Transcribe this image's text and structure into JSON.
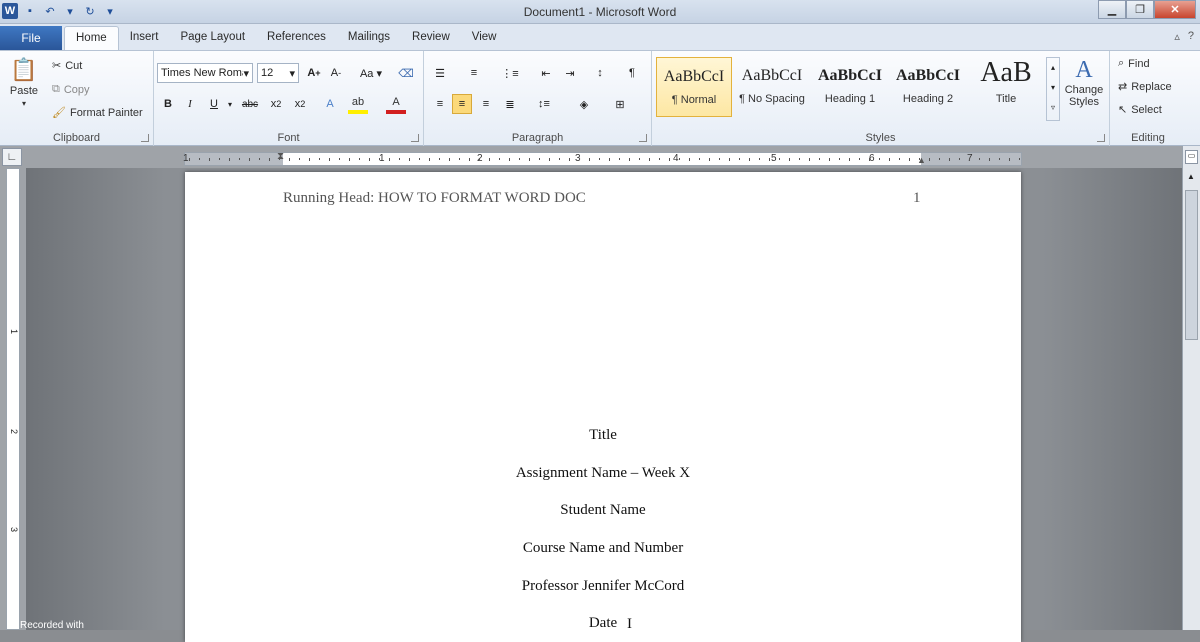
{
  "window": {
    "title": "Document1 - Microsoft Word"
  },
  "ribbon_tabs": [
    "Home",
    "Insert",
    "Page Layout",
    "References",
    "Mailings",
    "Review",
    "View"
  ],
  "file_tab": "File",
  "clipboard": {
    "paste": "Paste",
    "cut": "Cut",
    "copy": "Copy",
    "format_painter": "Format Painter",
    "label": "Clipboard"
  },
  "font": {
    "name": "Times New Roman",
    "size": "12",
    "label": "Font"
  },
  "paragraph": {
    "label": "Paragraph"
  },
  "styles": {
    "items": [
      {
        "sample": "AaBbCcI",
        "name": "¶ Normal"
      },
      {
        "sample": "AaBbCcI",
        "name": "¶ No Spacing"
      },
      {
        "sample": "AaBbCcI",
        "name": "Heading 1"
      },
      {
        "sample": "AaBbCcI",
        "name": "Heading 2"
      },
      {
        "sample": "AaB",
        "name": "Title"
      }
    ],
    "change_styles": "Change Styles",
    "label": "Styles"
  },
  "editing": {
    "find": "Find",
    "replace": "Replace",
    "select": "Select",
    "label": "Editing"
  },
  "ruler": {
    "numbers": [
      "1",
      "1",
      "2",
      "3",
      "4",
      "5",
      "6",
      "7"
    ],
    "vnumbers": [
      "1",
      "2",
      "3"
    ]
  },
  "document": {
    "running_head": "Running Head: HOW TO FORMAT WORD DOC",
    "page_number": "1",
    "lines": [
      "Title",
      "Assignment Name – Week X",
      "Student Name",
      "Course Name and Number",
      "Professor Jennifer McCord",
      "Date"
    ]
  },
  "overlay": {
    "recorded": "Recorded with"
  }
}
